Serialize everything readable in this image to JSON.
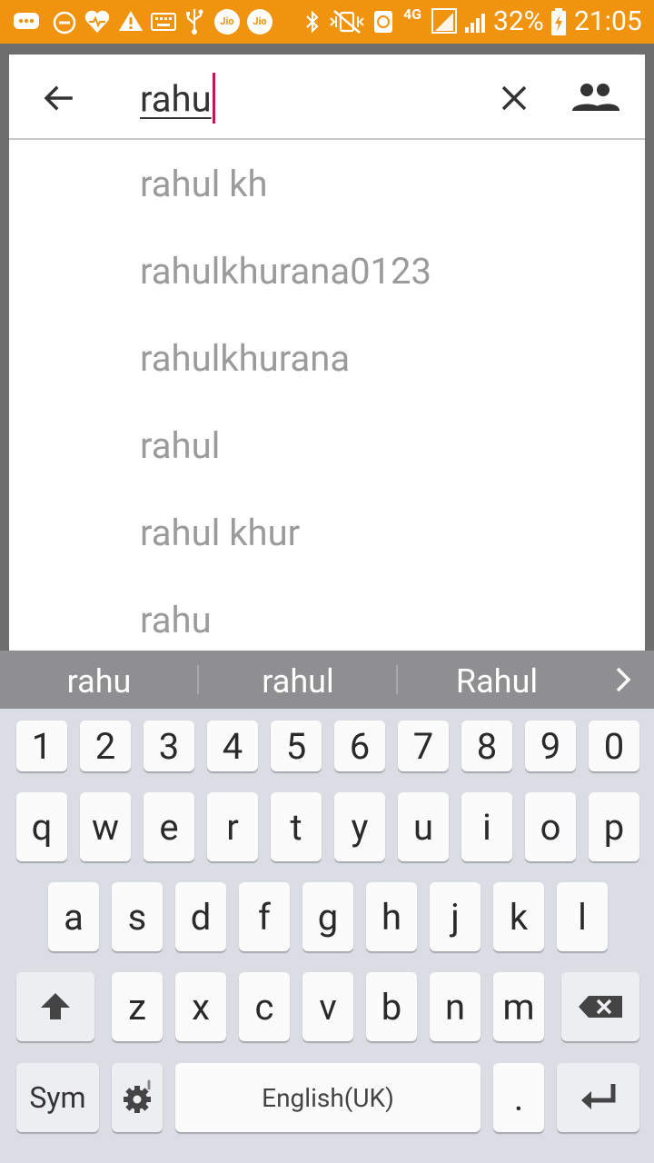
{
  "status_bar": {
    "battery_percent": "32%",
    "time": "21:05",
    "network": "4G",
    "carrier_badge": "Jio",
    "icons": [
      "messages-icon",
      "do-not-disturb-icon",
      "health-icon",
      "warning-icon",
      "keyboard-icon",
      "usb-icon",
      "jio-icon",
      "jio-icon",
      "bluetooth-icon",
      "vibrate-icon",
      "data-saver-icon",
      "4g-icon",
      "signal-icon",
      "signal-icon",
      "battery-charging-icon"
    ]
  },
  "search": {
    "query": "rahu",
    "back_icon": "arrow-back-icon",
    "clear_icon": "close-icon",
    "contacts_icon": "people-icon"
  },
  "suggestions": [
    {
      "label": "rahul kh"
    },
    {
      "label": "rahulkhurana0123"
    },
    {
      "label": "rahulkhurana"
    },
    {
      "label": "rahul"
    },
    {
      "label": "rahul khur"
    },
    {
      "label": "rahu"
    }
  ],
  "keyboard": {
    "predictions": [
      "rahu",
      "rahul",
      "Rahul"
    ],
    "number_row": [
      "1",
      "2",
      "3",
      "4",
      "5",
      "6",
      "7",
      "8",
      "9",
      "0"
    ],
    "row1": [
      "q",
      "w",
      "e",
      "r",
      "t",
      "y",
      "u",
      "i",
      "o",
      "p"
    ],
    "row2": [
      "a",
      "s",
      "d",
      "f",
      "g",
      "h",
      "j",
      "k",
      "l"
    ],
    "row3": [
      "z",
      "x",
      "c",
      "v",
      "b",
      "n",
      "m"
    ],
    "sym_label": "Sym",
    "space_label": "English(UK)",
    "period_label": "."
  }
}
